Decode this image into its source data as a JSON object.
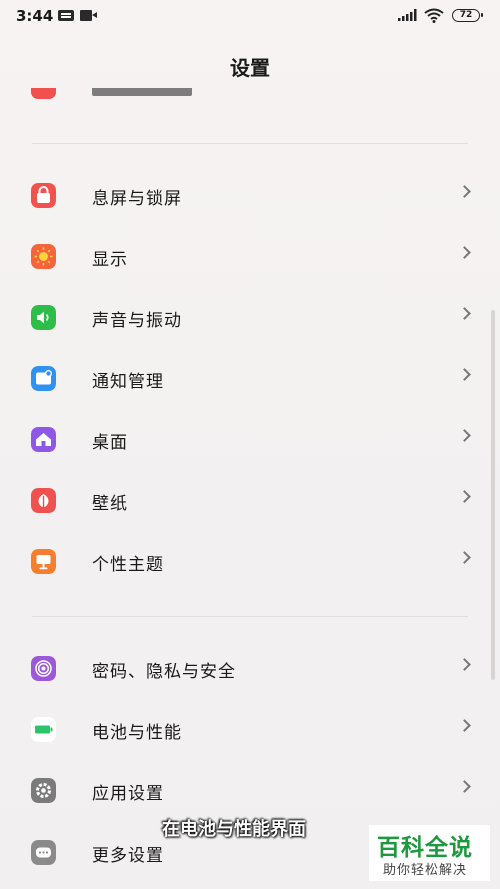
{
  "status_bar": {
    "time": "3:44",
    "battery": "72"
  },
  "header": {
    "title": "设置"
  },
  "sections": [
    {
      "items": [
        {
          "label": "息屏与锁屏",
          "icon": "lock-icon",
          "color": "#f1524d"
        },
        {
          "label": "显示",
          "icon": "sun-icon",
          "color": "#f6643d"
        },
        {
          "label": "声音与振动",
          "icon": "speaker-icon",
          "color": "#2dbd48"
        },
        {
          "label": "通知管理",
          "icon": "notification-icon",
          "color": "#2f92f2"
        },
        {
          "label": "桌面",
          "icon": "home-icon",
          "color": "#8e57e6"
        },
        {
          "label": "壁纸",
          "icon": "wallpaper-icon",
          "color": "#f0504e"
        },
        {
          "label": "个性主题",
          "icon": "theme-icon",
          "color": "#f57f2f"
        }
      ]
    },
    {
      "items": [
        {
          "label": "密码、隐私与安全",
          "icon": "fingerprint-icon",
          "color": "#9b59d9"
        },
        {
          "label": "电池与性能",
          "icon": "battery-icon",
          "color": "#2cc46b"
        },
        {
          "label": "应用设置",
          "icon": "gear-icon",
          "color": "#7b7b7b"
        },
        {
          "label": "更多设置",
          "icon": "more-icon",
          "color": "#8a8a8a"
        }
      ]
    }
  ],
  "overlay": {
    "caption": "在电池与性能界面"
  },
  "watermark": {
    "title": "百科全说",
    "subtitle": "助你轻松解决"
  }
}
